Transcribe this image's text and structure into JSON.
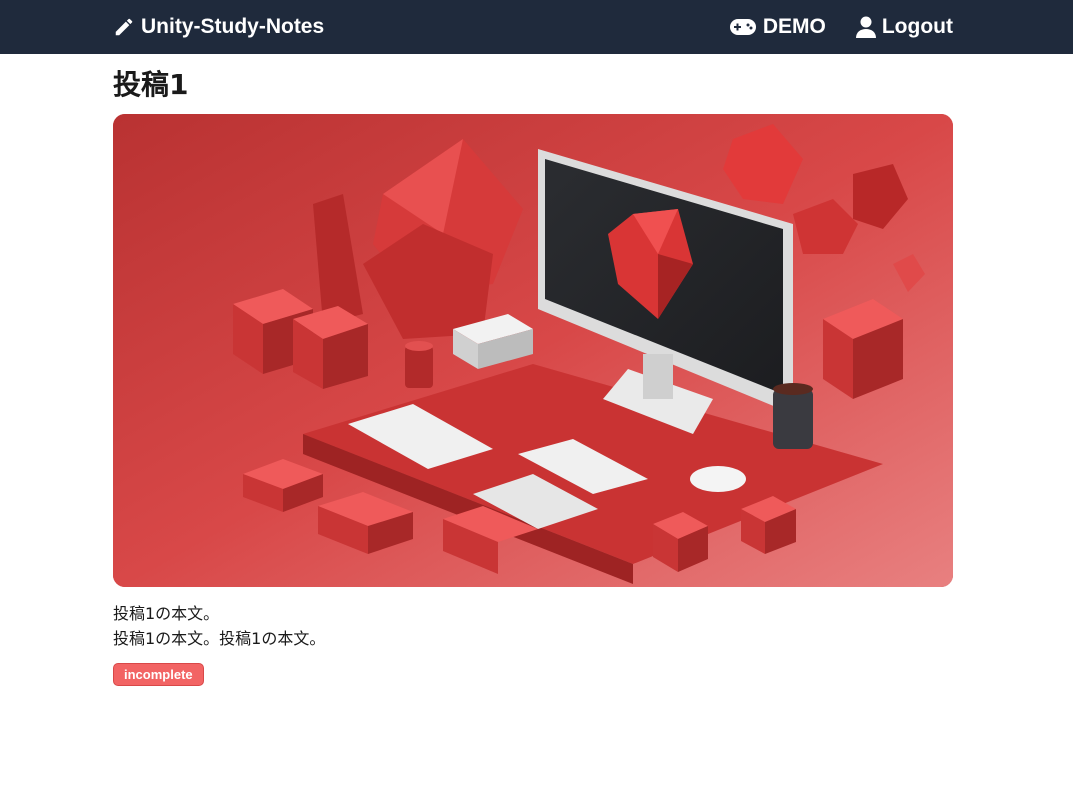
{
  "header": {
    "brand_title": "Unity-Study-Notes",
    "brand_icon": "pencil-icon",
    "nav": [
      {
        "label": "DEMO",
        "icon": "gamepad-icon"
      },
      {
        "label": "Logout",
        "icon": "user-icon"
      }
    ]
  },
  "post": {
    "title": "投稿1",
    "body_lines": [
      "投稿1の本文。",
      "投稿1の本文。投稿1の本文。"
    ],
    "status_badge": "incomplete",
    "status_color": "#f26464"
  },
  "colors": {
    "navbar_bg": "#1f2a3c",
    "accent_red": "#d94141"
  }
}
